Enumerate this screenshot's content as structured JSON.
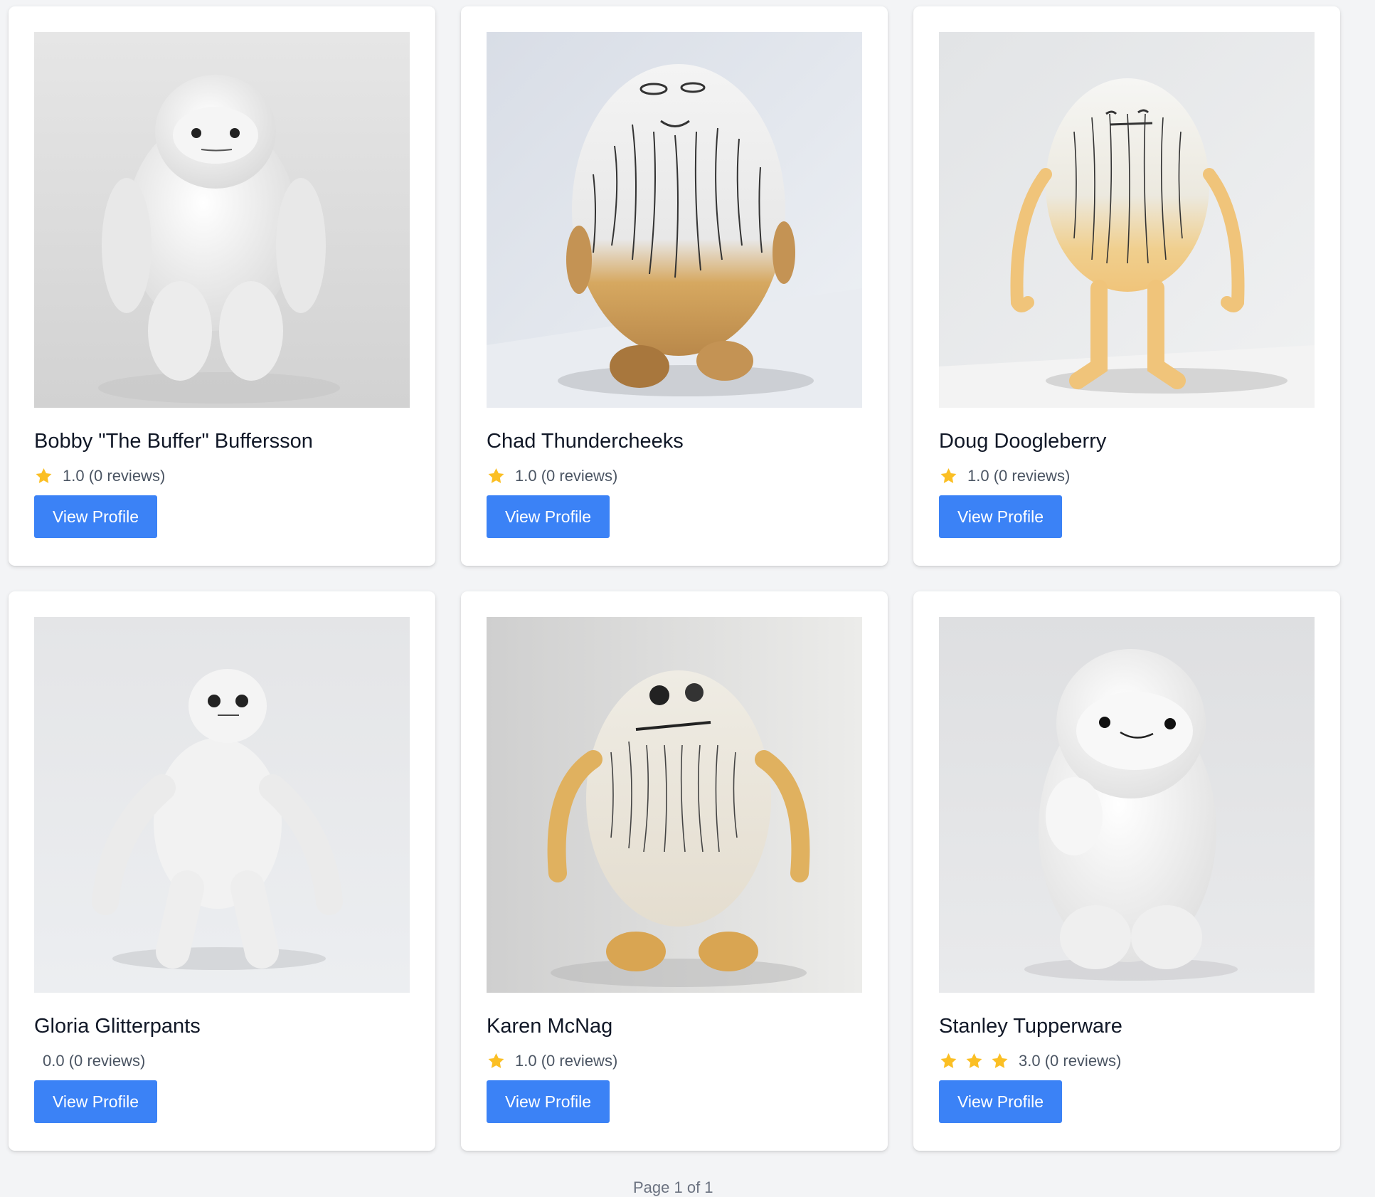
{
  "cards": [
    {
      "name": "Bobby \"The Buffer\" Buffersson",
      "stars": 1,
      "rating_text": "1.0 (0 reviews)",
      "button": "View Profile",
      "figure": "fluffy-white-yeti"
    },
    {
      "name": "Chad Thundercheeks",
      "stars": 1,
      "rating_text": "1.0 (0 reviews)",
      "button": "View Profile",
      "figure": "sketched-egg-creature"
    },
    {
      "name": "Doug Doogleberry",
      "stars": 1,
      "rating_text": "1.0 (0 reviews)",
      "button": "View Profile",
      "figure": "sketched-egg-creature-long-arms"
    },
    {
      "name": "Gloria Glitterpants",
      "stars": 0,
      "rating_text": "0.0 (0 reviews)",
      "button": "View Profile",
      "figure": "shaggy-white-yeti"
    },
    {
      "name": "Karen McNag",
      "stars": 1,
      "rating_text": "1.0 (0 reviews)",
      "button": "View Profile",
      "figure": "sketched-egg-creature-arms"
    },
    {
      "name": "Stanley Tupperware",
      "stars": 3,
      "rating_text": "3.0 (0 reviews)",
      "button": "View Profile",
      "figure": "fluffy-white-yeti-smiling"
    }
  ],
  "pagination": {
    "text": "Page 1 of 1"
  },
  "colors": {
    "star": "#fbbf24",
    "button": "#3b82f6",
    "background": "#f3f4f6"
  }
}
